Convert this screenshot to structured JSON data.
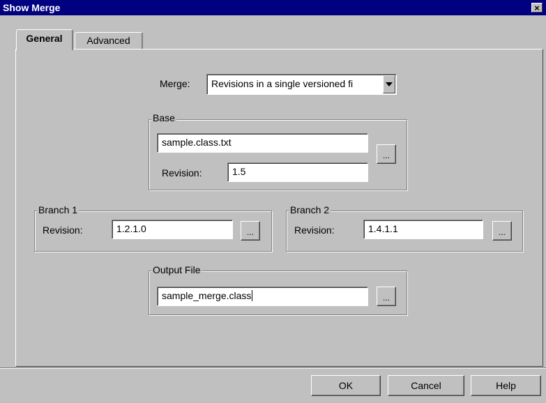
{
  "window": {
    "title": "Show Merge",
    "close_glyph": "×"
  },
  "tabs": [
    {
      "label": "General",
      "active": true
    },
    {
      "label": "Advanced",
      "active": false
    }
  ],
  "merge": {
    "label": "Merge:",
    "value": "Revisions in a single versioned fi"
  },
  "base": {
    "legend": "Base",
    "file_value": "sample.class.txt",
    "revision_label": "Revision:",
    "revision_value": "1.5",
    "browse_label": "..."
  },
  "branch1": {
    "legend": "Branch 1",
    "revision_label": "Revision:",
    "revision_value": "1.2.1.0",
    "browse_label": "..."
  },
  "branch2": {
    "legend": "Branch 2",
    "revision_label": "Revision:",
    "revision_value": "1.4.1.1",
    "browse_label": "..."
  },
  "output": {
    "legend": "Output File",
    "file_value": "sample_merge.class",
    "browse_label": "..."
  },
  "buttons": {
    "ok": "OK",
    "cancel": "Cancel",
    "help": "Help"
  },
  "colors": {
    "title_bar": "#000080",
    "face": "#c0c0c0"
  },
  "icons": {
    "close": "close-icon",
    "dropdown": "chevron-down-icon"
  }
}
